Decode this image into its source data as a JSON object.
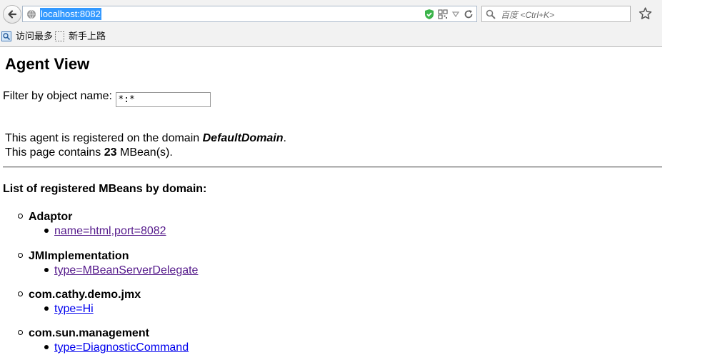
{
  "browser": {
    "url": "localhost:8082",
    "search_placeholder": "百度 <Ctrl+K>",
    "bookmarks": [
      {
        "label": "访问最多",
        "icon": "most-visited-icon"
      },
      {
        "label": "新手上路",
        "icon": "blank-page-icon"
      }
    ]
  },
  "page": {
    "title": "Agent View",
    "filter_label": "Filter by object name:",
    "filter_value": "*:*",
    "domain_prefix": "This agent is registered on the domain ",
    "domain_name": "DefaultDomain",
    "domain_suffix": ".",
    "count_prefix": "This page contains ",
    "count": "23",
    "count_suffix": " MBean(s).",
    "list_heading": "List of registered MBeans by domain:",
    "domains": [
      {
        "name": "Adaptor",
        "mbeans": [
          "name=html,port=8082"
        ]
      },
      {
        "name": "JMImplementation",
        "mbeans": [
          "type=MBeanServerDelegate"
        ]
      },
      {
        "name": "com.cathy.demo.jmx",
        "mbeans": [
          "type=Hi"
        ]
      },
      {
        "name": "com.sun.management",
        "mbeans": [
          "type=DiagnosticCommand"
        ]
      }
    ]
  },
  "colors": {
    "visited_link": "#551a8b",
    "unvisited_link": "#0000ee",
    "url_selection": "#3399ff"
  }
}
